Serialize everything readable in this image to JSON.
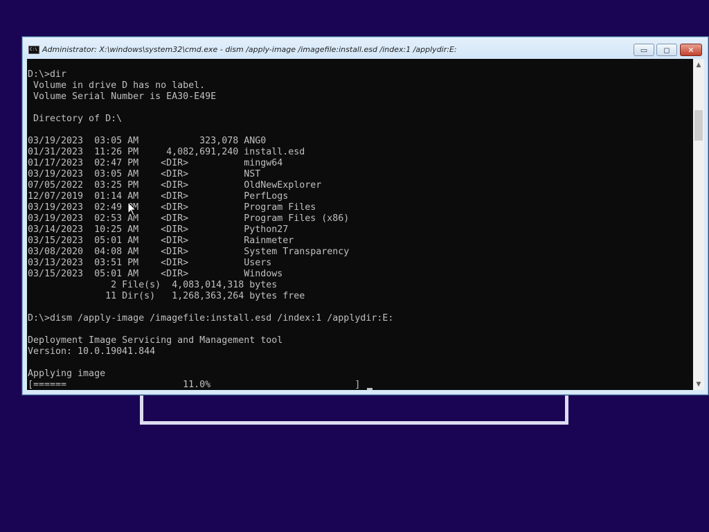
{
  "window": {
    "title": "Administrator: X:\\windows\\system32\\cmd.exe - dism  /apply-image /imagefile:install.esd /index:1 /applydir:E:",
    "icon_label": "C:\\",
    "minimize_glyph": "▭",
    "maximize_glyph": "◻",
    "close_glyph": "✕"
  },
  "console": {
    "lines": [
      "D:\\>dir",
      " Volume in drive D has no label.",
      " Volume Serial Number is EA30-E49E",
      "",
      " Directory of D:\\",
      "",
      "03/19/2023  03:05 AM           323,078 ANG0",
      "01/31/2023  11:26 PM     4,082,691,240 install.esd",
      "01/17/2023  02:47 PM    <DIR>          mingw64",
      "03/19/2023  03:05 AM    <DIR>          NST",
      "07/05/2022  03:25 PM    <DIR>          OldNewExplorer",
      "12/07/2019  01:14 AM    <DIR>          PerfLogs",
      "03/19/2023  02:49 PM    <DIR>          Program Files",
      "03/19/2023  02:53 AM    <DIR>          Program Files (x86)",
      "03/14/2023  10:25 AM    <DIR>          Python27",
      "03/15/2023  05:01 AM    <DIR>          Rainmeter",
      "03/08/2020  04:08 AM    <DIR>          System Transparency",
      "03/13/2023  03:51 PM    <DIR>          Users",
      "03/15/2023  05:01 AM    <DIR>          Windows",
      "               2 File(s)  4,083,014,318 bytes",
      "              11 Dir(s)   1,268,363,264 bytes free",
      "",
      "D:\\>dism /apply-image /imagefile:install.esd /index:1 /applydir:E:",
      "",
      "Deployment Image Servicing and Management tool",
      "Version: 10.0.19041.844",
      "",
      "Applying image",
      "[======                     11.0%                          ]"
    ],
    "progress_percent": 11.0
  },
  "scrollbar": {
    "up_glyph": "▲",
    "down_glyph": "▼"
  }
}
